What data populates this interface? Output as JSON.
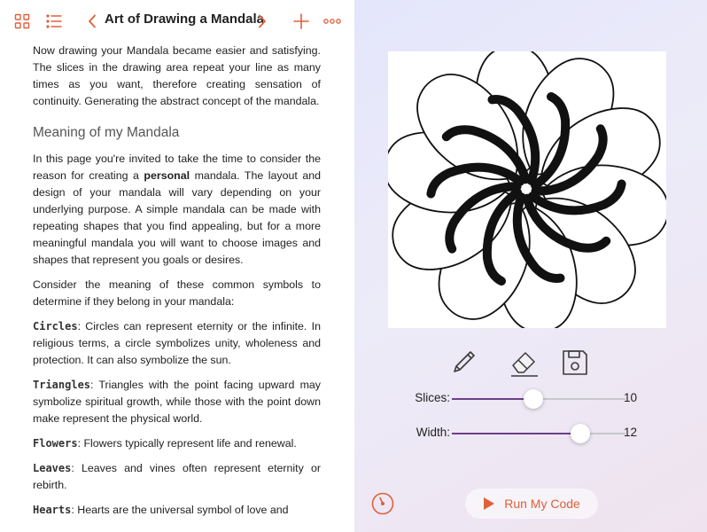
{
  "toolbar": {
    "title": "Art of Drawing a Mandala",
    "icons": [
      "grid-icon",
      "list-icon",
      "chevron-left-icon",
      "chevron-right-icon",
      "plus-icon",
      "more-icon"
    ],
    "icon_color": "#e0603a"
  },
  "doc": {
    "intro": "Now drawing your Mandala became easier and satisfying. The slices in the drawing area repeat your line as many times as you want, therefore creating sensation of continuity. Generating the abstract concept of the mandala.",
    "heading": "Meaning of my Mandala",
    "p1_before": "In this page you're invited to take the time to consider the reason for creating a ",
    "p1_bold": "personal",
    "p1_after": " mandala. The layout and design of your mandala will vary depending on your underlying purpose. A simple mandala can be made with repeating shapes that you find appealing, but for a more meaningful mandala you will want to choose images and shapes that represent you goals or desires.",
    "p2": "Consider the meaning of these common symbols to determine if they belong in your mandala:",
    "symbols": [
      {
        "term": "Circles",
        "text": ": Circles can represent eternity or the infinite. In religious terms, a circle symbolizes unity, wholeness and protection. It can also symbolize the sun."
      },
      {
        "term": "Triangles",
        "text": ": Triangles with the point facing upward may symbolize spiritual growth, while those with the point down make represent the physical world."
      },
      {
        "term": "Flowers",
        "text": ": Flowers typically represent life and renewal."
      },
      {
        "term": "Leaves",
        "text": ": Leaves and vines often represent eternity or rebirth."
      },
      {
        "term": "Hearts",
        "text": ": Hearts are the universal symbol of love and"
      }
    ]
  },
  "playground": {
    "tools": [
      "pencil-icon",
      "eraser-icon",
      "save-icon"
    ],
    "sliders": [
      {
        "label": "Slices:",
        "value": "10",
        "fraction": 0.47
      },
      {
        "label": "Width:",
        "value": "12",
        "fraction": 0.74
      }
    ],
    "run_label": "Run My Code",
    "accent": "#e0603a",
    "slider_fill_color": "#6b3f8c"
  },
  "mandala": {
    "petals": 10,
    "stroke_color": "#111111"
  }
}
